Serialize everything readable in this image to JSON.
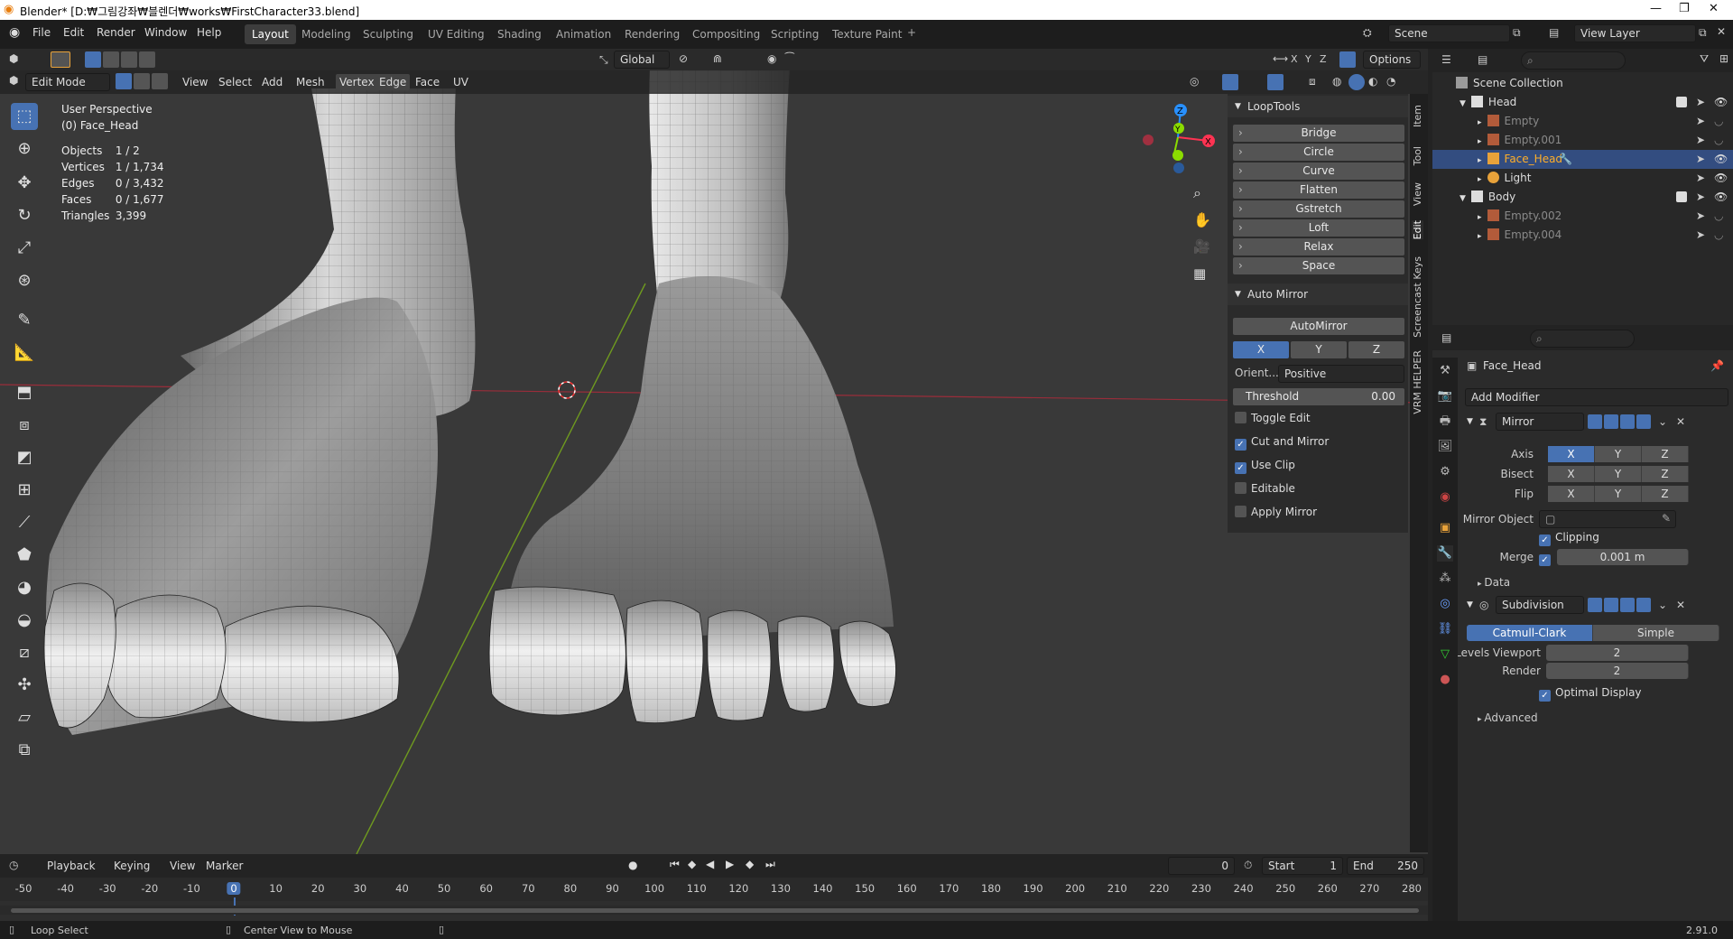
{
  "window": {
    "title": "Blender* [D:₩그림강좌₩블렌더₩works₩FirstCharacter33.blend]"
  },
  "menus": [
    "File",
    "Edit",
    "Render",
    "Window",
    "Help"
  ],
  "workspaces": [
    "Layout",
    "Modeling",
    "Sculpting",
    "UV Editing",
    "Shading",
    "Animation",
    "Rendering",
    "Compositing",
    "Scripting",
    "Texture Paint"
  ],
  "active_workspace": "Layout",
  "scene": "Scene",
  "view_layer": "View Layer",
  "viewport": {
    "mode": "Edit Mode",
    "header_menus": [
      "View",
      "Select",
      "Add",
      "Mesh",
      "Vertex",
      "Edge",
      "Face",
      "UV"
    ],
    "transform_orientation": "Global",
    "options_label": "Options",
    "perspective": "User Perspective",
    "object_label": "(0) Face_Head",
    "stats": [
      {
        "k": "Objects",
        "v": "1 / 2"
      },
      {
        "k": "Vertices",
        "v": "1 / 1,734"
      },
      {
        "k": "Edges",
        "v": "0 / 3,432"
      },
      {
        "k": "Faces",
        "v": "0 / 1,677"
      },
      {
        "k": "Triangles",
        "v": "3,399"
      }
    ],
    "gizmo": {
      "x": "X",
      "y": "Y",
      "z": "Z"
    },
    "xyz": [
      "X",
      "Y",
      "Z"
    ]
  },
  "npanel": {
    "looptools_title": "LoopTools",
    "looptools": [
      "Bridge",
      "Circle",
      "Curve",
      "Flatten",
      "Gstretch",
      "Loft",
      "Relax",
      "Space"
    ],
    "automirror_title": "Auto Mirror",
    "automirror_button": "AutoMirror",
    "axes": [
      "X",
      "Y",
      "Z"
    ],
    "orient_label": "Orient...",
    "orient_value": "Positive",
    "threshold_label": "Threshold",
    "threshold_value": "0.00",
    "checks": [
      {
        "label": "Toggle Edit",
        "checked": false
      },
      {
        "label": "Cut and Mirror",
        "checked": true
      },
      {
        "label": "Use Clip",
        "checked": true
      },
      {
        "label": "Editable",
        "checked": false
      },
      {
        "label": "Apply Mirror",
        "checked": false
      }
    ],
    "tabs": [
      "Item",
      "Tool",
      "View",
      "Edit",
      "Screencast Keys",
      "VRM HELPER"
    ]
  },
  "outliner": {
    "root": "Scene Collection",
    "items": [
      {
        "name": "Head",
        "level": 1,
        "dim": false
      },
      {
        "name": "Empty",
        "level": 2,
        "dim": true
      },
      {
        "name": "Empty.001",
        "level": 2,
        "dim": true
      },
      {
        "name": "Face_Head",
        "level": 2,
        "dim": false,
        "selected": true
      },
      {
        "name": "Light",
        "level": 2,
        "dim": false
      },
      {
        "name": "Body",
        "level": 1,
        "dim": false
      },
      {
        "name": "Empty.002",
        "level": 2,
        "dim": true
      },
      {
        "name": "Empty.004",
        "level": 2,
        "dim": true
      }
    ]
  },
  "properties": {
    "object": "Face_Head",
    "add_modifier": "Add Modifier",
    "mirror": {
      "name": "Mirror",
      "axis_label": "Axis",
      "bisect_label": "Bisect",
      "flip_label": "Flip",
      "mirror_object_label": "Mirror Object",
      "clipping_label": "Clipping",
      "merge_label": "Merge",
      "merge_value": "0.001 m",
      "data_label": "Data"
    },
    "subdivision": {
      "name": "Subdivision",
      "catmull": "Catmull-Clark",
      "simple": "Simple",
      "levels_viewport_label": "Levels Viewport",
      "levels_viewport": "2",
      "render_label": "Render",
      "render": "2",
      "optimal_label": "Optimal Display",
      "advanced_label": "Advanced"
    }
  },
  "timeline": {
    "menus": [
      "Playback",
      "Keying",
      "View",
      "Marker"
    ],
    "current_frame": "0",
    "start_label": "Start",
    "start": "1",
    "end_label": "End",
    "end": "250",
    "ruler": [
      "-50",
      "-40",
      "-30",
      "-20",
      "-10",
      "0",
      "10",
      "20",
      "30",
      "40",
      "50",
      "60",
      "70",
      "80",
      "90",
      "100",
      "110",
      "120",
      "130",
      "140",
      "150",
      "160",
      "170",
      "180",
      "190",
      "200",
      "210",
      "220",
      "230",
      "240",
      "250",
      "260",
      "270",
      "280"
    ]
  },
  "status": {
    "left": "Loop Select",
    "middle": "Center View to Mouse",
    "version": "2.91.0"
  },
  "colors": {
    "accent": "#4772b3",
    "viewport_bg": "#393939",
    "x_axis": "#ff3352",
    "y_axis": "#8bdc00",
    "z_axis": "#2890ff"
  }
}
